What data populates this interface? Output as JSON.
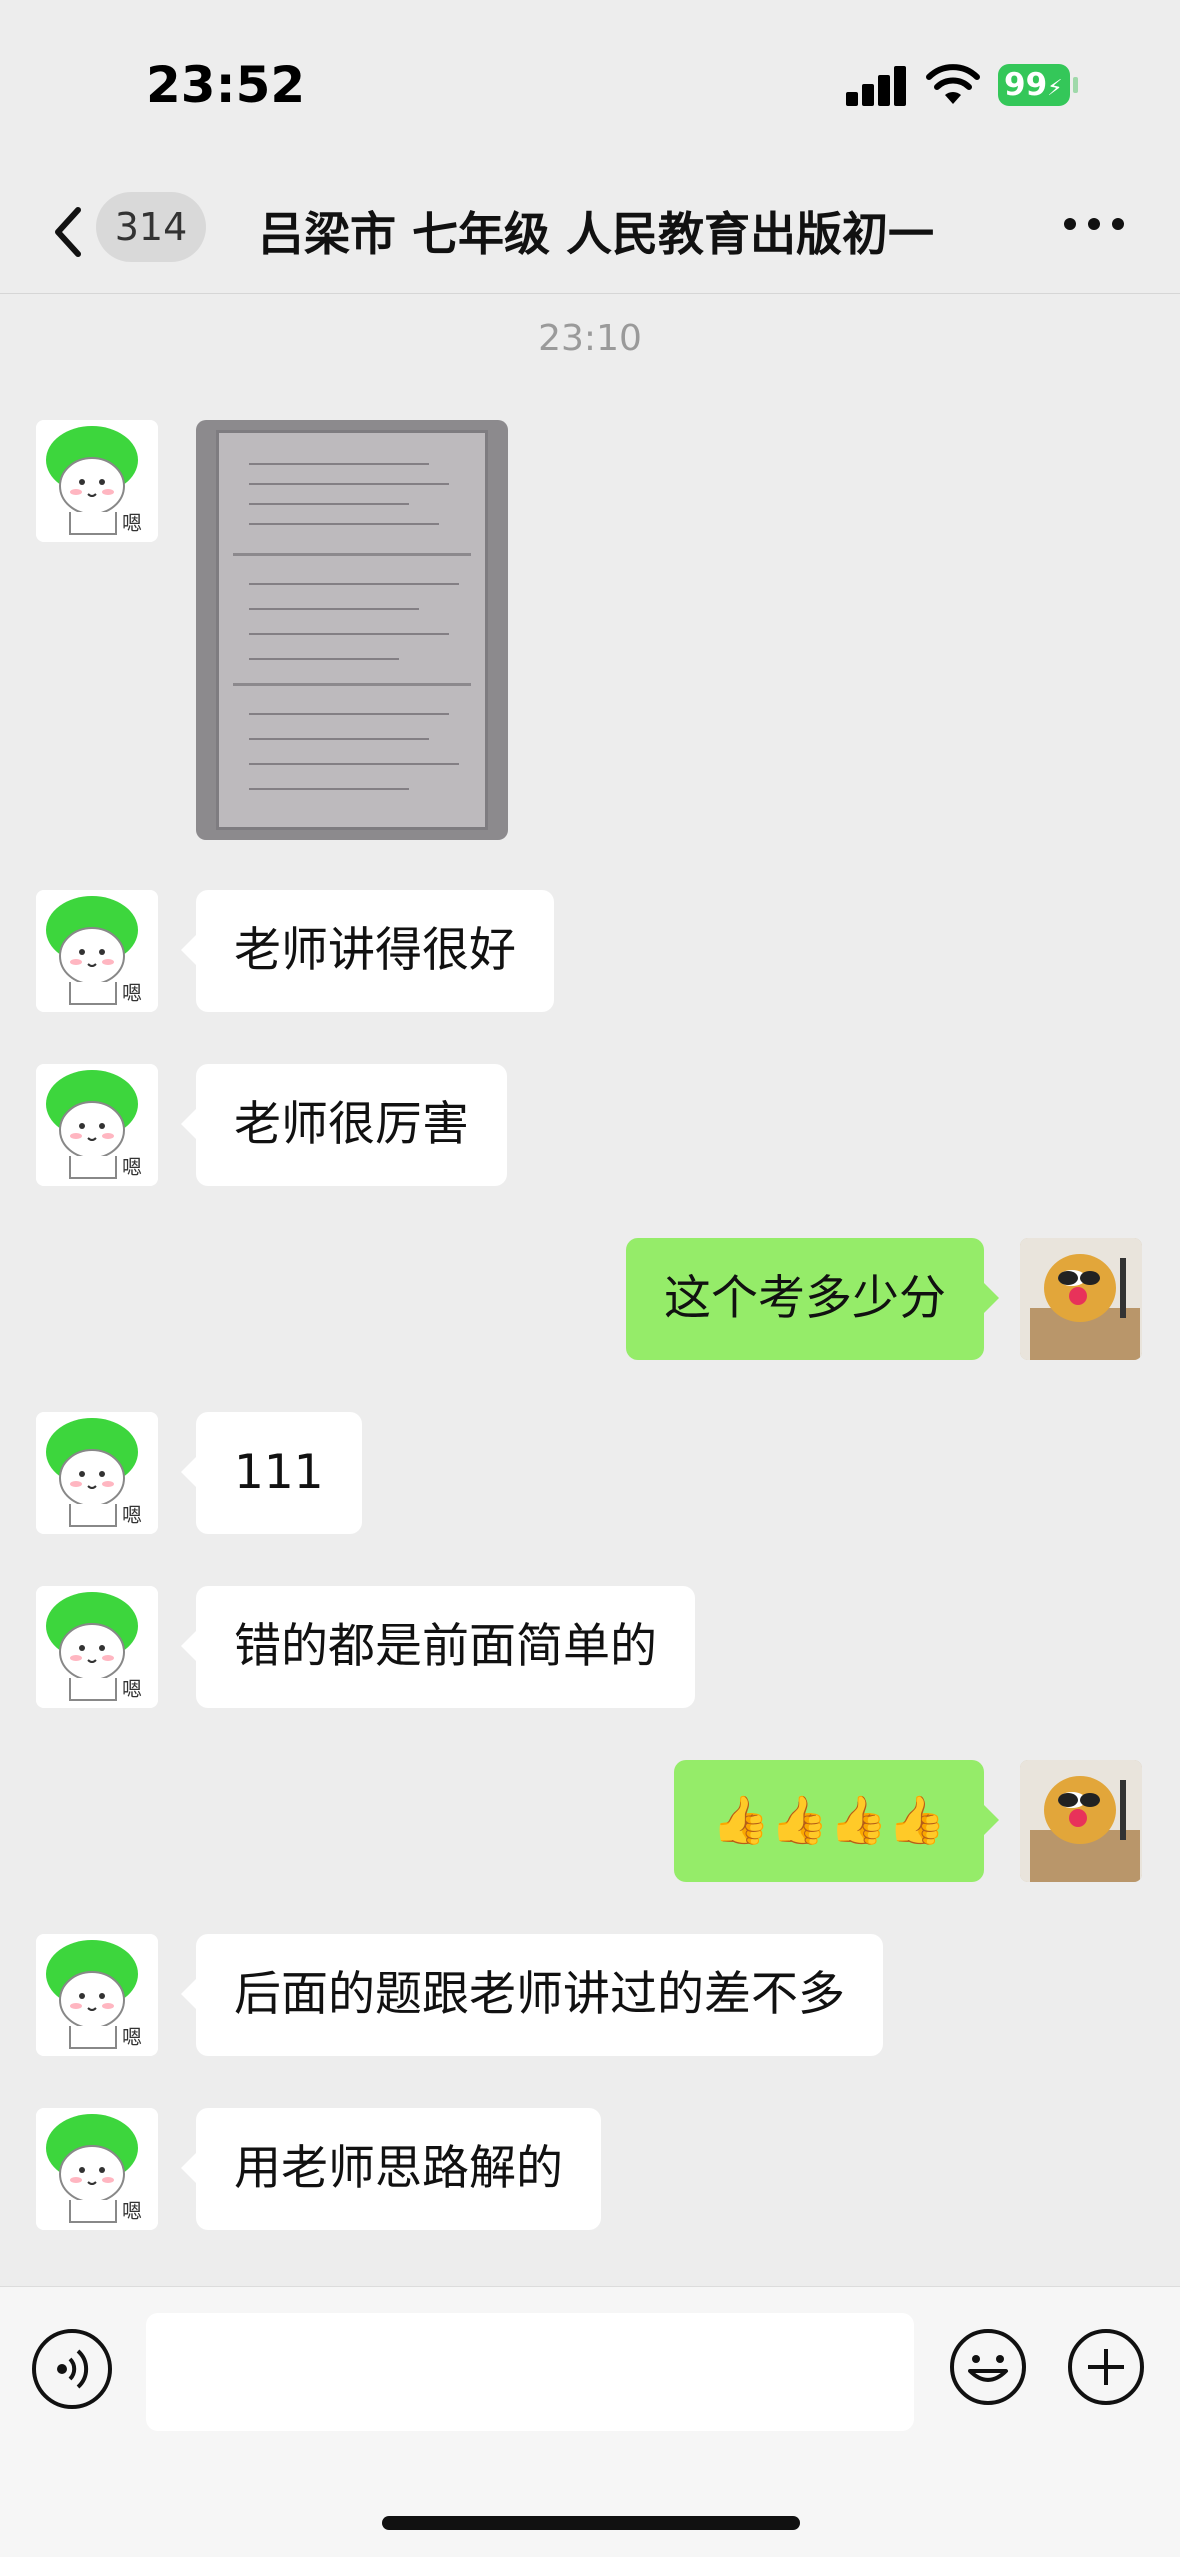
{
  "status_bar": {
    "time": "23:52",
    "battery": "99"
  },
  "header": {
    "back_count": "314",
    "title": "吕梁市 七年级 人民教育出版初一"
  },
  "chat": {
    "timestamp": "23:10",
    "messages": [
      {
        "from": "other",
        "type": "image"
      },
      {
        "from": "other",
        "text": "老师讲得很好"
      },
      {
        "from": "other",
        "text": "老师很厉害"
      },
      {
        "from": "me",
        "text": "这个考多少分"
      },
      {
        "from": "other",
        "text": "111"
      },
      {
        "from": "other",
        "text": "错的都是前面简单的"
      },
      {
        "from": "me",
        "text": "👍👍👍👍"
      },
      {
        "from": "other",
        "text": "后面的题跟老师讲过的差不多"
      },
      {
        "from": "other",
        "text": "用老师思路解的"
      }
    ]
  },
  "icons": {
    "back": "chevron-left-icon",
    "more": "more-horizontal-icon",
    "voice": "voice-icon",
    "emoji": "emoji-icon",
    "plus": "plus-icon"
  },
  "colors": {
    "my_bubble": "#95ec69",
    "their_bubble": "#ffffff",
    "background": "#ededed"
  }
}
